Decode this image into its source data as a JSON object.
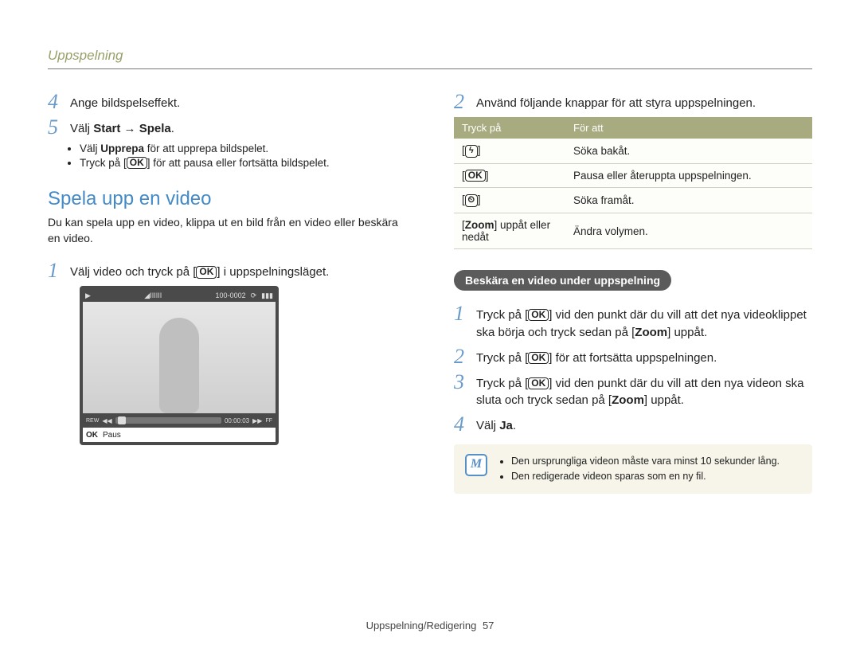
{
  "header": "Uppspelning",
  "left": {
    "step4": "Ange bildspelseffekt.",
    "step5_text": "Välj ",
    "step5_bold1": "Start",
    "step5_arrow": " → ",
    "step5_bold2": "Spela",
    "step5_after": ".",
    "bullets": {
      "b1_pre": "Välj ",
      "b1_bold": "Upprepa",
      "b1_post": " för att upprepa bildspelet.",
      "b2_pre": "Tryck på [",
      "b2_post": "] för att pausa eller fortsätta bildspelet."
    },
    "section_title": "Spela upp en video",
    "section_intro": "Du kan spela upp en video, klippa ut en bild från en video eller beskära en video.",
    "step1_pre": "Välj video och tryck på [",
    "step1_post": "] i uppspelningsläget.",
    "screenshot": {
      "counter": "100-0002",
      "time": "00:00:03",
      "rew": "REW",
      "ff": "FF",
      "ok": "OK",
      "paus": "Paus"
    }
  },
  "right": {
    "step2": "Använd följande knappar för att styra uppspelningen.",
    "table": {
      "head1": "Tryck på",
      "head2": "För att",
      "rows": [
        {
          "key_icon": "⚡",
          "action": "Söka bakåt."
        },
        {
          "key_ok": true,
          "action": "Pausa eller återuppta uppspelningen."
        },
        {
          "key_icon": "⏱",
          "action": "Söka framåt."
        },
        {
          "key_text_pre": "[",
          "key_text_bold": "Zoom",
          "key_text_post": "] uppåt eller nedåt",
          "action": "Ändra volymen."
        }
      ]
    },
    "pill": "Beskära en video under uppspelning",
    "step1_pre": "Tryck på [",
    "step1_mid": "] vid den punkt där du vill att det nya videoklippet ska börja och tryck sedan på [",
    "step1_bold": "Zoom",
    "step1_post": "] uppåt.",
    "s2_pre": "Tryck på [",
    "s2_post": "] för att fortsätta uppspelningen.",
    "s3_pre": "Tryck på [",
    "s3_mid": "] vid den punkt där du vill att den nya videon ska sluta och tryck sedan på [",
    "s3_bold": "Zoom",
    "s3_post": "] uppåt.",
    "s4_pre": "Välj ",
    "s4_bold": "Ja",
    "s4_post": ".",
    "notes": [
      "Den ursprungliga videon måste vara minst 10 sekunder lång.",
      "Den redigerade videon sparas som en ny fil."
    ]
  },
  "footer": {
    "label": "Uppspelning/Redigering",
    "page": "57"
  }
}
